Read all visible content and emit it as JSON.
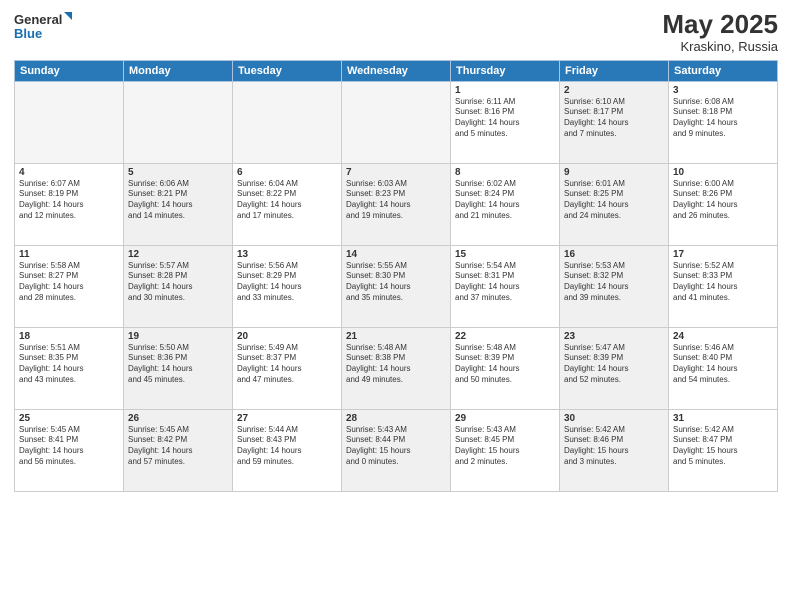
{
  "header": {
    "logo_line1": "General",
    "logo_line2": "Blue",
    "month_year": "May 2025",
    "location": "Kraskino, Russia"
  },
  "days_of_week": [
    "Sunday",
    "Monday",
    "Tuesday",
    "Wednesday",
    "Thursday",
    "Friday",
    "Saturday"
  ],
  "weeks": [
    [
      {
        "day": "",
        "data": "",
        "shaded": true
      },
      {
        "day": "",
        "data": "",
        "shaded": true
      },
      {
        "day": "",
        "data": "",
        "shaded": true
      },
      {
        "day": "",
        "data": "",
        "shaded": true
      },
      {
        "day": "1",
        "data": "Sunrise: 6:11 AM\nSunset: 8:16 PM\nDaylight: 14 hours\nand 5 minutes.",
        "shaded": false
      },
      {
        "day": "2",
        "data": "Sunrise: 6:10 AM\nSunset: 8:17 PM\nDaylight: 14 hours\nand 7 minutes.",
        "shaded": true
      },
      {
        "day": "3",
        "data": "Sunrise: 6:08 AM\nSunset: 8:18 PM\nDaylight: 14 hours\nand 9 minutes.",
        "shaded": false
      }
    ],
    [
      {
        "day": "4",
        "data": "Sunrise: 6:07 AM\nSunset: 8:19 PM\nDaylight: 14 hours\nand 12 minutes.",
        "shaded": false
      },
      {
        "day": "5",
        "data": "Sunrise: 6:06 AM\nSunset: 8:21 PM\nDaylight: 14 hours\nand 14 minutes.",
        "shaded": true
      },
      {
        "day": "6",
        "data": "Sunrise: 6:04 AM\nSunset: 8:22 PM\nDaylight: 14 hours\nand 17 minutes.",
        "shaded": false
      },
      {
        "day": "7",
        "data": "Sunrise: 6:03 AM\nSunset: 8:23 PM\nDaylight: 14 hours\nand 19 minutes.",
        "shaded": true
      },
      {
        "day": "8",
        "data": "Sunrise: 6:02 AM\nSunset: 8:24 PM\nDaylight: 14 hours\nand 21 minutes.",
        "shaded": false
      },
      {
        "day": "9",
        "data": "Sunrise: 6:01 AM\nSunset: 8:25 PM\nDaylight: 14 hours\nand 24 minutes.",
        "shaded": true
      },
      {
        "day": "10",
        "data": "Sunrise: 6:00 AM\nSunset: 8:26 PM\nDaylight: 14 hours\nand 26 minutes.",
        "shaded": false
      }
    ],
    [
      {
        "day": "11",
        "data": "Sunrise: 5:58 AM\nSunset: 8:27 PM\nDaylight: 14 hours\nand 28 minutes.",
        "shaded": false
      },
      {
        "day": "12",
        "data": "Sunrise: 5:57 AM\nSunset: 8:28 PM\nDaylight: 14 hours\nand 30 minutes.",
        "shaded": true
      },
      {
        "day": "13",
        "data": "Sunrise: 5:56 AM\nSunset: 8:29 PM\nDaylight: 14 hours\nand 33 minutes.",
        "shaded": false
      },
      {
        "day": "14",
        "data": "Sunrise: 5:55 AM\nSunset: 8:30 PM\nDaylight: 14 hours\nand 35 minutes.",
        "shaded": true
      },
      {
        "day": "15",
        "data": "Sunrise: 5:54 AM\nSunset: 8:31 PM\nDaylight: 14 hours\nand 37 minutes.",
        "shaded": false
      },
      {
        "day": "16",
        "data": "Sunrise: 5:53 AM\nSunset: 8:32 PM\nDaylight: 14 hours\nand 39 minutes.",
        "shaded": true
      },
      {
        "day": "17",
        "data": "Sunrise: 5:52 AM\nSunset: 8:33 PM\nDaylight: 14 hours\nand 41 minutes.",
        "shaded": false
      }
    ],
    [
      {
        "day": "18",
        "data": "Sunrise: 5:51 AM\nSunset: 8:35 PM\nDaylight: 14 hours\nand 43 minutes.",
        "shaded": false
      },
      {
        "day": "19",
        "data": "Sunrise: 5:50 AM\nSunset: 8:36 PM\nDaylight: 14 hours\nand 45 minutes.",
        "shaded": true
      },
      {
        "day": "20",
        "data": "Sunrise: 5:49 AM\nSunset: 8:37 PM\nDaylight: 14 hours\nand 47 minutes.",
        "shaded": false
      },
      {
        "day": "21",
        "data": "Sunrise: 5:48 AM\nSunset: 8:38 PM\nDaylight: 14 hours\nand 49 minutes.",
        "shaded": true
      },
      {
        "day": "22",
        "data": "Sunrise: 5:48 AM\nSunset: 8:39 PM\nDaylight: 14 hours\nand 50 minutes.",
        "shaded": false
      },
      {
        "day": "23",
        "data": "Sunrise: 5:47 AM\nSunset: 8:39 PM\nDaylight: 14 hours\nand 52 minutes.",
        "shaded": true
      },
      {
        "day": "24",
        "data": "Sunrise: 5:46 AM\nSunset: 8:40 PM\nDaylight: 14 hours\nand 54 minutes.",
        "shaded": false
      }
    ],
    [
      {
        "day": "25",
        "data": "Sunrise: 5:45 AM\nSunset: 8:41 PM\nDaylight: 14 hours\nand 56 minutes.",
        "shaded": false
      },
      {
        "day": "26",
        "data": "Sunrise: 5:45 AM\nSunset: 8:42 PM\nDaylight: 14 hours\nand 57 minutes.",
        "shaded": true
      },
      {
        "day": "27",
        "data": "Sunrise: 5:44 AM\nSunset: 8:43 PM\nDaylight: 14 hours\nand 59 minutes.",
        "shaded": false
      },
      {
        "day": "28",
        "data": "Sunrise: 5:43 AM\nSunset: 8:44 PM\nDaylight: 15 hours\nand 0 minutes.",
        "shaded": true
      },
      {
        "day": "29",
        "data": "Sunrise: 5:43 AM\nSunset: 8:45 PM\nDaylight: 15 hours\nand 2 minutes.",
        "shaded": false
      },
      {
        "day": "30",
        "data": "Sunrise: 5:42 AM\nSunset: 8:46 PM\nDaylight: 15 hours\nand 3 minutes.",
        "shaded": true
      },
      {
        "day": "31",
        "data": "Sunrise: 5:42 AM\nSunset: 8:47 PM\nDaylight: 15 hours\nand 5 minutes.",
        "shaded": false
      }
    ]
  ]
}
